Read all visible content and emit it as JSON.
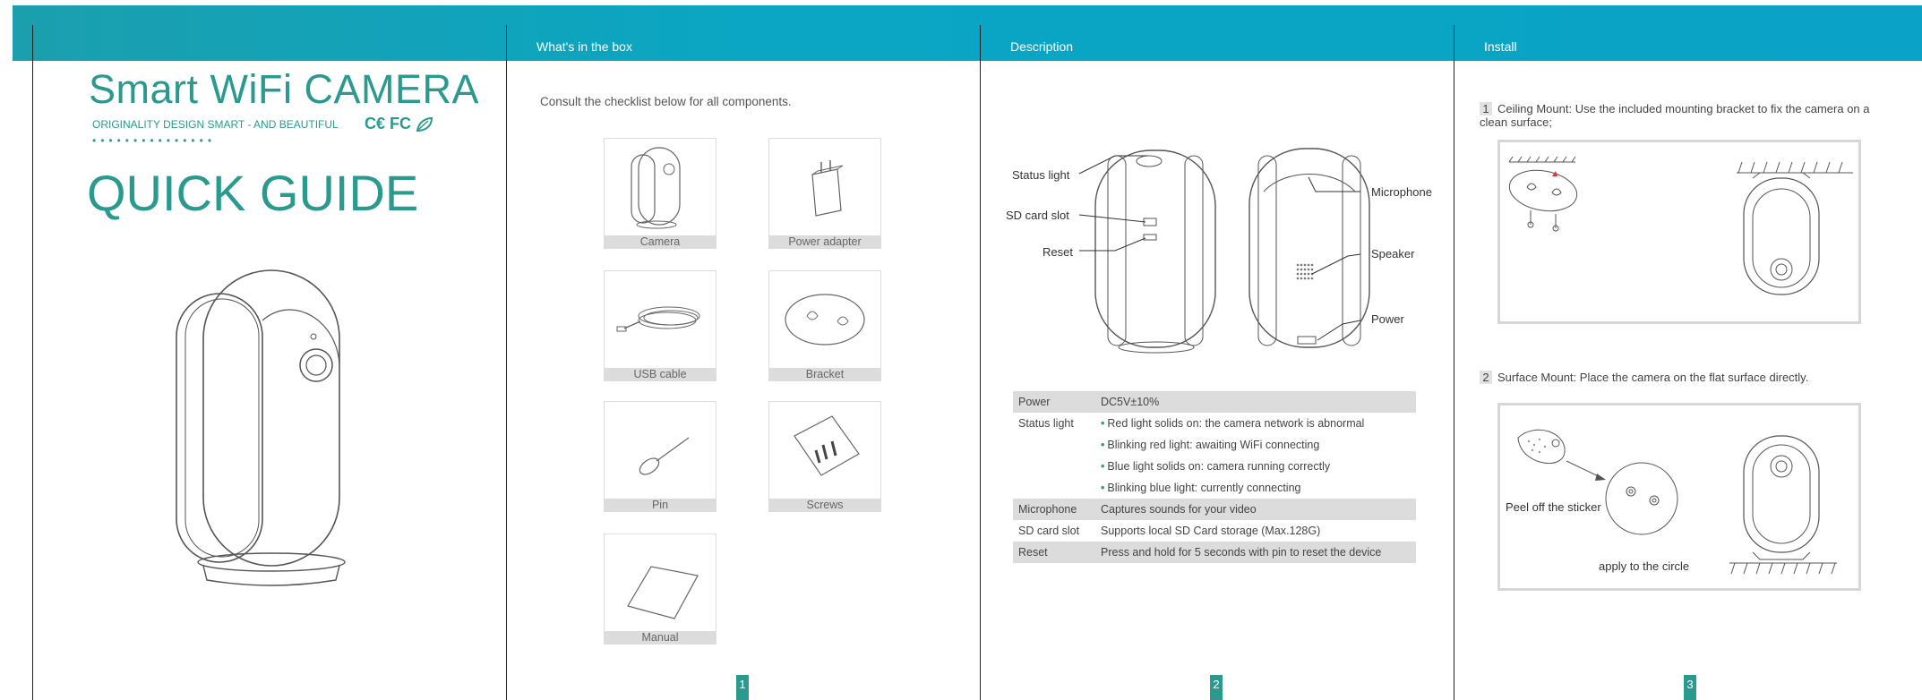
{
  "cover": {
    "title": "Smart WiFi CAMERA",
    "subtitle": "ORIGINALITY DESIGN SMART - AND BEAUTIFUL",
    "certs": "C€ FC",
    "heading": "QUICK GUIDE"
  },
  "box_page": {
    "header": "What's in the box",
    "intro": "Consult the checklist below for all components.",
    "items": [
      "Camera",
      "Power adapter",
      "USB cable",
      "Bracket",
      "Pin",
      "Screws",
      "Manual"
    ],
    "page_number": "1"
  },
  "description_page": {
    "header": "Description",
    "callouts": {
      "status_light": "Status light",
      "sd_card_slot": "SD card slot",
      "reset": "Reset",
      "microphone": "Microphone",
      "speaker": "Speaker",
      "power": "Power"
    },
    "spec": {
      "power_label": "Power",
      "power_value": "DC5V±10%",
      "status_label": "Status light",
      "status_values": [
        "Red light solids on: the camera network is abnormal",
        "Blinking red light: awaiting WiFi connecting",
        "Blue light solids on: camera running correctly",
        "Blinking blue light: currently connecting"
      ],
      "mic_label": "Microphone",
      "mic_value": "Captures sounds for your video",
      "sd_label": "SD card slot",
      "sd_value": "Supports local SD Card storage (Max.128G)",
      "reset_label": "Reset",
      "reset_value": "Press and hold for 5 seconds with pin to reset the device"
    },
    "page_number": "2"
  },
  "install_page": {
    "header": "Install",
    "step1_num": "1",
    "step1_text": "Ceiling Mount: Use the included mounting bracket to fix the camera on a clean surface;",
    "step2_num": "2",
    "step2_text": "Surface Mount: Place the camera on the flat surface directly.",
    "peel_label": "Peel off the sticker",
    "apply_label": "apply to the circle",
    "page_number": "3"
  }
}
